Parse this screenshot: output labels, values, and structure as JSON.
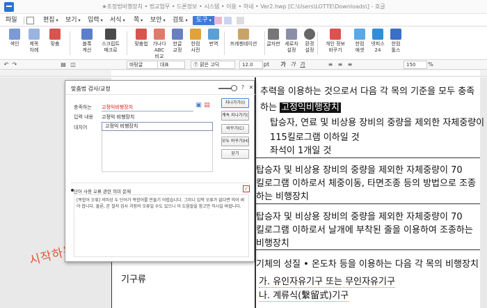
{
  "window": {
    "title": "★조정법비행장치 • 법교업무 • 드론정보  • 시스템 • 이용 • 하네 • Ver2.hwp [C:\\Users\\LOTTE\\Downloads\\] - 호글"
  },
  "menu": {
    "items": [
      "파일",
      "편집",
      "보기",
      "입력",
      "서식",
      "쪽",
      "보안",
      "검토",
      "도구"
    ],
    "active": "도구"
  },
  "ribbon": {
    "buttons": [
      "색인",
      "제목\n차례",
      "맞춤",
      "블록\n계산",
      "스크립트\n매크로",
      "맞춤법",
      "가나다\nABC\n비교",
      "한글\n교정",
      "한컴\n사전",
      "번역",
      "프레젠테이션",
      "글자판",
      "세로자\n설정",
      "환경\n설정",
      "개인 정보\n바꾸기",
      "한컴\n애셋",
      "넷피스\n24",
      "한컴\n툴스"
    ]
  },
  "format_bar": {
    "style": "바탕글",
    "font_lang": "대표",
    "font": "맑은 고딕",
    "size": "12.0",
    "unit": "pt",
    "zoom": "150",
    "zoom_unit": "%"
  },
  "dialog": {
    "title": "맞춤법 검사/교정",
    "checking_label": "충족하는",
    "checking_value": "고정익비행장치",
    "input_label": "입력 내용",
    "input_value": "고정익 비행장치",
    "replace_label": "대치어",
    "replace_value": "고정익 비행장치",
    "buttons": [
      "지나가기(I)",
      "계속 지나가기(S)",
      "바꾸기(C)",
      "모두 바꾸기(H)",
      "닫기"
    ],
    "info_heading": "단어 사용 오류 관련 의미 문제",
    "info_text": "[복합어 오류] 의미상 두 단어가 복합어를 만들기 어렵습니다. 그러니 입력 오류가 없다면 띄어 써야 합니다. 물론, 본 철저 검사 과정의 오류일 수도 있으니 이 도움말을 참고만 하시길 바랍니다."
  },
  "document": {
    "rows": [
      {
        "lines": [
          {
            "text": "추력을 이용하는 것으로서 다음 각 목의 기준을 모두 충족"
          },
          {
            "before": "하는 ",
            "highlight": "고정익비행장치"
          },
          {
            "text": "탑승자, 연료 및 비상용 장비의 중량을 제외한 자체중량이"
          },
          {
            "text": "115킬로그램 이하일 것"
          },
          {
            "text": "좌석이 1개일 것"
          }
        ]
      },
      {
        "lines": [
          {
            "text": "탑승자 및 비상용 장비의 중량을 제외한 자체중량이 70"
          },
          {
            "text": "킬로그램 이하로서 체중이동, 타면조종 등의 방법으로 조종"
          },
          {
            "text": "하는 비행장치"
          }
        ]
      },
      {
        "lines": [
          {
            "text": "탑승자 및 비상용 장비의 중량을 제외한 자체중량이 70"
          },
          {
            "text": "킬로그램 이하로서 날개에 부착된 줄을 이용하여 조종하는"
          },
          {
            "text": "비행장치"
          }
        ]
      },
      {
        "left_label": "기구류",
        "lines": [
          {
            "text": "기체의 성질 • 온도차 등을 이용하는 다음 각 목의 비행장치"
          },
          {
            "text": "가. 유인자유기구 또는 무인자유기구"
          },
          {
            "text": "나. 계류식(繫留式)기구"
          }
        ]
      }
    ]
  },
  "annotation": "시작하는 지천명"
}
